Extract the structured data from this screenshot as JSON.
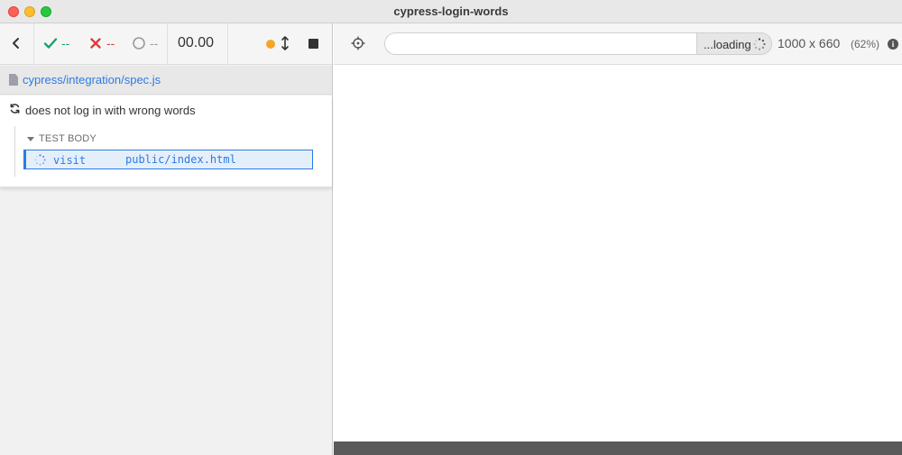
{
  "window": {
    "title": "cypress-login-words"
  },
  "reporter": {
    "stats": {
      "passed": "--",
      "failed": "--",
      "pending": "--",
      "duration": "00.00"
    },
    "spec_path": "cypress/integration/spec.js",
    "test": {
      "title": "does not log in with wrong words",
      "hook_label": "TEST BODY",
      "command": {
        "name": "visit",
        "message": "public/index.html"
      }
    }
  },
  "aut": {
    "url_value": "",
    "loading_text": "...loading",
    "viewport_size": "1000 x 660",
    "viewport_scale": "(62%)"
  },
  "icons": {
    "back": "chevron-left-icon",
    "passed": "check-icon",
    "failed": "x-icon",
    "pending": "circle-icon",
    "auto_scroll": "dot-icon",
    "scroll": "up-down-arrows-icon",
    "stop": "stop-icon",
    "file": "file-icon",
    "refresh": "refresh-icon",
    "caret": "caret-down-icon",
    "spinner": "spinner-icon",
    "selector": "crosshair-icon",
    "info": "info-icon"
  },
  "colors": {
    "passed": "#1aa26b",
    "failed": "#e13b3b",
    "accent": "#2c7be5",
    "auto_scroll": "#f6a623"
  }
}
